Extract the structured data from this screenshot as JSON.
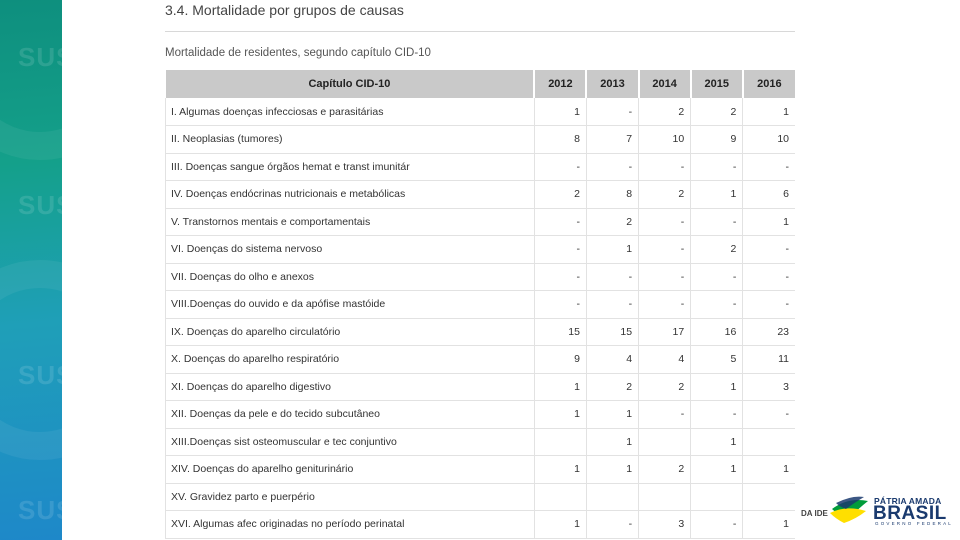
{
  "document": {
    "title": "3.4. Mortalidade por grupos de causas",
    "subtitle": "Mortalidade de residentes, segundo capítulo CID-10"
  },
  "table": {
    "headers": [
      "Capítulo CID-10",
      "2012",
      "2013",
      "2014",
      "2015",
      "2016"
    ],
    "rows": [
      [
        "I. Algumas doenças infecciosas e parasitárias",
        "1",
        "-",
        "2",
        "2",
        "1"
      ],
      [
        "II. Neoplasias (tumores)",
        "8",
        "7",
        "10",
        "9",
        "10"
      ],
      [
        "III. Doenças sangue órgãos hemat e transt imunitár",
        "-",
        "-",
        "-",
        "-",
        "-"
      ],
      [
        "IV. Doenças endócrinas nutricionais e metabólicas",
        "2",
        "8",
        "2",
        "1",
        "6"
      ],
      [
        "V. Transtornos mentais e comportamentais",
        "-",
        "2",
        "-",
        "-",
        "1"
      ],
      [
        "VI. Doenças do sistema nervoso",
        "-",
        "1",
        "-",
        "2",
        "-"
      ],
      [
        "VII. Doenças do olho e anexos",
        "-",
        "-",
        "-",
        "-",
        "-"
      ],
      [
        "VIII.Doenças do ouvido e da apófise mastóide",
        "-",
        "-",
        "-",
        "-",
        "-"
      ],
      [
        "IX. Doenças do aparelho circulatório",
        "15",
        "15",
        "17",
        "16",
        "23"
      ],
      [
        "X. Doenças do aparelho respiratório",
        "9",
        "4",
        "4",
        "5",
        "11"
      ],
      [
        "XI. Doenças do aparelho digestivo",
        "1",
        "2",
        "2",
        "1",
        "3"
      ],
      [
        "XII. Doenças da pele e do tecido subcutâneo",
        "1",
        "1",
        "-",
        "-",
        "-"
      ],
      [
        "XIII.Doenças sist osteomuscular e tec conjuntivo",
        "",
        "1",
        "",
        "1",
        ""
      ],
      [
        "XIV. Doenças do aparelho geniturinário",
        "1",
        "1",
        "2",
        "1",
        "1"
      ],
      [
        "XV. Gravidez parto e puerpério",
        "",
        "",
        "",
        "",
        ""
      ],
      [
        "XVI. Algumas afec originadas no período perinatal",
        "1",
        "-",
        "3",
        "-",
        "1"
      ]
    ]
  },
  "branding": {
    "line1": "PÁTRIA AMADA",
    "line2": "BRASIL",
    "line3": "GOVERNO FEDERAL",
    "corner_text": "DA IDE",
    "colors": {
      "green": "#009c3b",
      "yellow": "#ffdf00",
      "blue": "#1a3a6e"
    }
  },
  "sidebar": {
    "watermark": "SUS",
    "gradient_colors": [
      "#0e8f7e",
      "#1e88c9"
    ]
  }
}
